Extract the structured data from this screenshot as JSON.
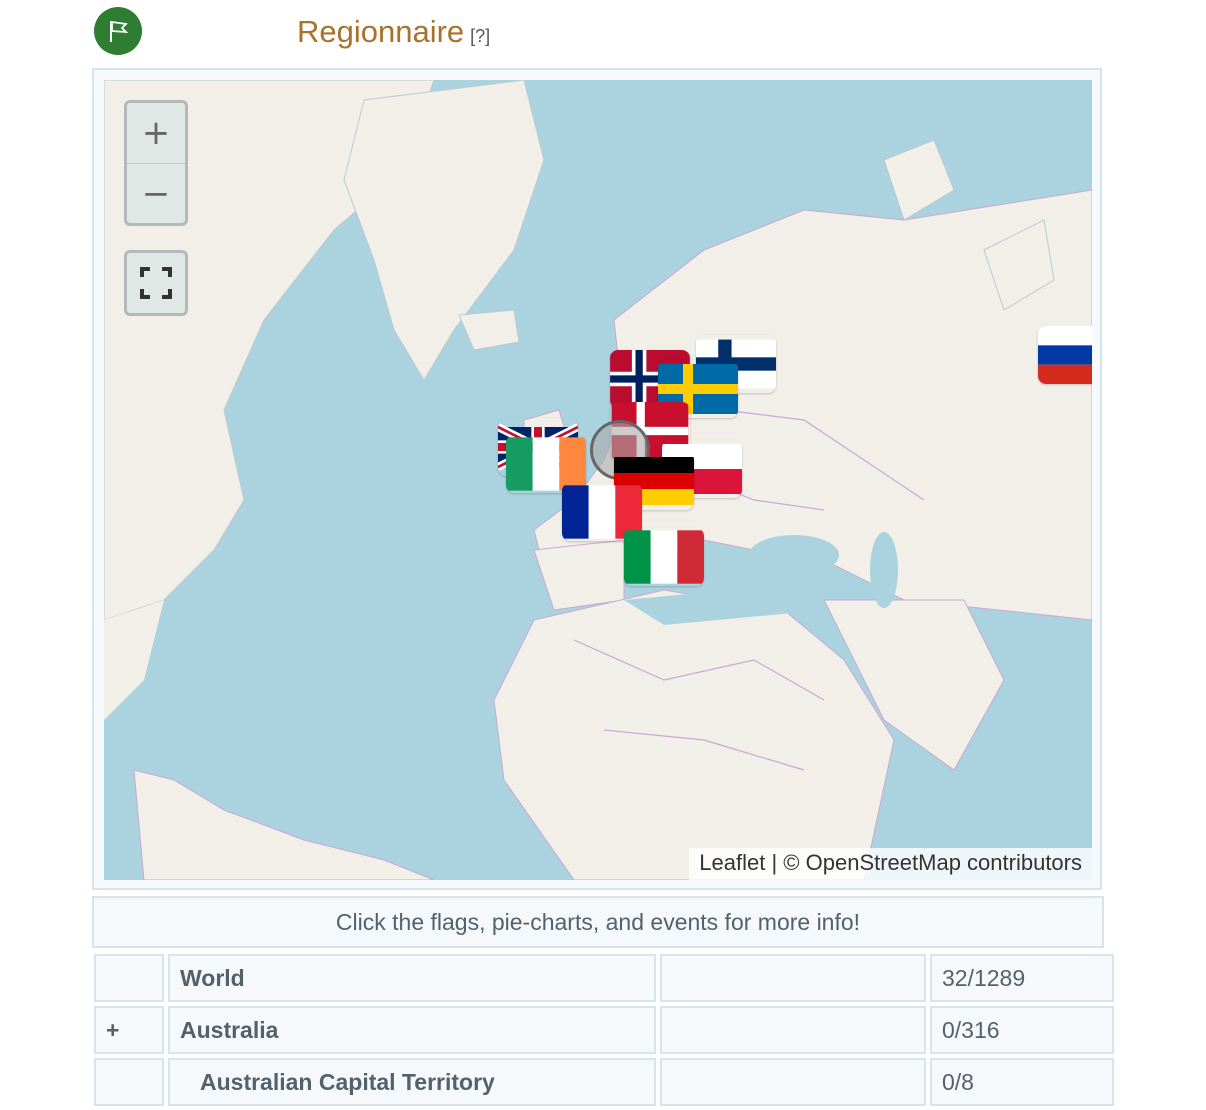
{
  "header": {
    "title": "Regionnaire",
    "help": "[?]",
    "icon": "flag-icon"
  },
  "map": {
    "zoom_in": "+",
    "zoom_out": "−",
    "fullscreen_icon": "fullscreen-icon",
    "attribution_leaflet": "Leaflet",
    "attribution_sep": " | © ",
    "attribution_osm": "OpenStreetMap",
    "attribution_rest": " contributors",
    "colors": {
      "water": "#aad3df",
      "land": "#f2efe9",
      "borders": "#c9a8d2"
    },
    "markers": [
      "Norway",
      "Finland",
      "Sweden",
      "Denmark",
      "United Kingdom",
      "Ireland",
      "Poland",
      "Germany",
      "France",
      "Italy",
      "Russia"
    ]
  },
  "info": "Click the flags, pie-charts, and events for more info!",
  "table": {
    "rows": [
      {
        "toggle": "",
        "name": "World",
        "count": "32/1289"
      },
      {
        "toggle": "+",
        "name": "Australia",
        "count": "0/316"
      },
      {
        "toggle": "",
        "name": "Australian Capital Territory",
        "count": "0/8"
      }
    ]
  }
}
